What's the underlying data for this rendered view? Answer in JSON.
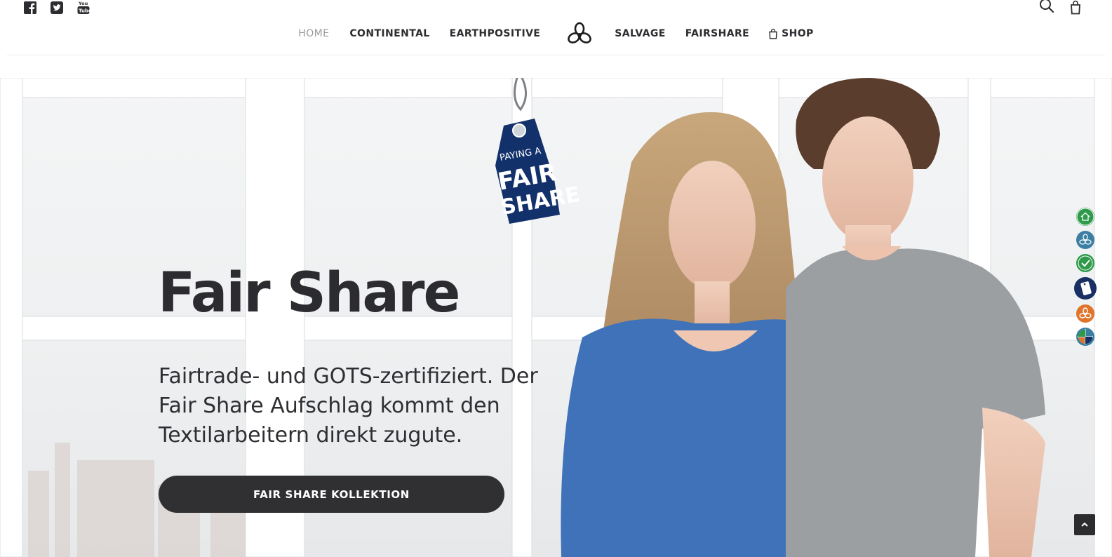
{
  "header": {
    "socials": [
      {
        "icon": "facebook-icon"
      },
      {
        "icon": "twitter-icon"
      },
      {
        "icon": "youtube-icon",
        "label": "You Tube"
      }
    ],
    "nav": [
      {
        "label": "HOME",
        "active": true
      },
      {
        "label": "CONTINENTAL"
      },
      {
        "label": "EARTHPOSITIVE"
      },
      {
        "label": "SALVAGE"
      },
      {
        "label": "FAIRSHARE"
      },
      {
        "label": "SHOP",
        "icon": "shopping-bag-icon"
      }
    ],
    "actions": {
      "search_icon": "search-icon",
      "cart_icon": "cart-icon"
    }
  },
  "hero": {
    "tag_line1": "PAYING A",
    "tag_line2": "FAIR",
    "tag_line3": "SHARE",
    "title": "Fair Share",
    "subtitle": "Fairtrade- und GOTS-zertifiziert. Der Fair Share Aufschlag kommt den Textilarbeitern direkt zugute.",
    "button_label": "FAIR SHARE KOLLEKTION"
  },
  "dot_nav": [
    {
      "icon": "home-icon",
      "color": "#2e9a4a"
    },
    {
      "icon": "continental-logo-icon",
      "color": "#3d7fa3"
    },
    {
      "icon": "earthpositive-check-icon",
      "color": "#2e9a4a"
    },
    {
      "icon": "fairshare-tag-icon",
      "color": "#1a2f63"
    },
    {
      "icon": "salvage-logo-icon",
      "color": "#e0742a"
    },
    {
      "icon": "shop-map-icon",
      "color": "#3d7fa3"
    }
  ],
  "colors": {
    "nav_text": "#2d2d31",
    "nav_active": "#9a9a9a",
    "button_bg": "#303033",
    "tag_blue": "#12306a"
  }
}
